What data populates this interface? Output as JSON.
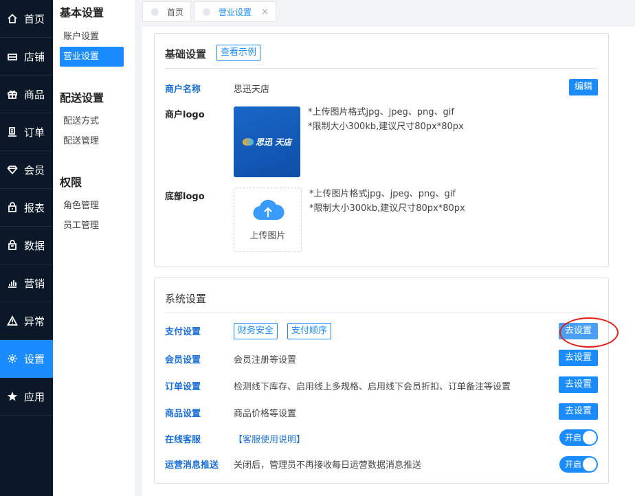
{
  "nav": [
    {
      "label": "首页",
      "icon": "home-icon"
    },
    {
      "label": "店铺",
      "icon": "store-icon"
    },
    {
      "label": "商品",
      "icon": "gift-icon"
    },
    {
      "label": "订单",
      "icon": "order-icon"
    },
    {
      "label": "会员",
      "icon": "diamond-icon"
    },
    {
      "label": "报表",
      "icon": "lock-bag-icon"
    },
    {
      "label": "数据",
      "icon": "bag-icon"
    },
    {
      "label": "营销",
      "icon": "bar-chart-icon"
    },
    {
      "label": "异常",
      "icon": "warning-icon"
    },
    {
      "label": "设置",
      "icon": "gear-icon"
    },
    {
      "label": "应用",
      "icon": "star-icon"
    }
  ],
  "sidebar": {
    "groups": [
      {
        "title": "基本设置",
        "items": [
          "账户设置",
          "营业设置"
        ]
      },
      {
        "title": "配送设置",
        "items": [
          "配送方式",
          "配送管理"
        ]
      },
      {
        "title": "权限",
        "items": [
          "角色管理",
          "员工管理"
        ]
      }
    ]
  },
  "tabs": [
    {
      "label": "首页"
    },
    {
      "label": "营业设置",
      "close": "×"
    }
  ],
  "basic": {
    "title": "基础设置",
    "example_btn": "查看示例",
    "merchant_name_label": "商户名称",
    "merchant_name": "思迅天店",
    "edit_btn": "编辑",
    "logo_label": "商户logo",
    "logo_text": "思迅 天店",
    "logo_hint1": "*上传图片格式jpg、jpeg、png、gif",
    "logo_hint2": "*限制大小300kb,建议尺寸80px*80px",
    "bottom_logo_label": "底部logo",
    "upload_label": "上传图片",
    "bottom_hint1": "*上传图片格式jpg、jpeg、png、gif",
    "bottom_hint2": "*限制大小300kb,建议尺寸80px*80px"
  },
  "system": {
    "title": "系统设置",
    "pay_label": "支付设置",
    "pay_btn1": "财务安全",
    "pay_btn2": "支付顺序",
    "go_setting": "去设置",
    "member_label": "会员设置",
    "member_desc": "会员注册等设置",
    "order_label": "订单设置",
    "order_desc": "检测线下库存、启用线上多规格、启用线下会员折扣、订单备注等设置",
    "goods_label": "商品设置",
    "goods_desc": "商品价格等设置",
    "service_label": "在线客服",
    "service_link": "【客服使用说明】",
    "push_label": "运营消息推送",
    "push_desc": "关闭后，管理员不再接收每日运营数据消息推送",
    "toggle_on": "开启"
  },
  "colors": {
    "accent": "#1a8cff",
    "nav_bg": "#0b1827",
    "highlight_ring": "#e0201a"
  }
}
